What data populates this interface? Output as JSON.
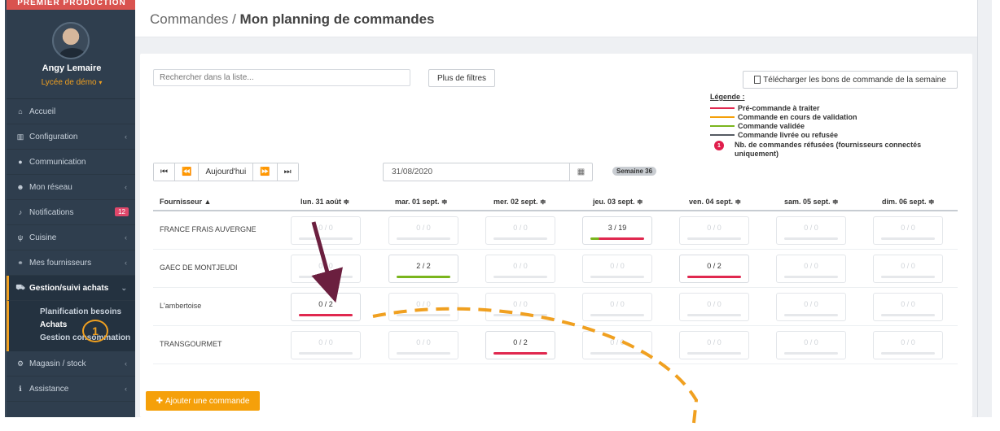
{
  "brand": "PREMIER PRODUCTION",
  "user": {
    "name": "Angy Lemaire",
    "school": "Lycée de démo"
  },
  "sidebar": {
    "items": [
      {
        "label": "Accueil",
        "icon": "home-icon"
      },
      {
        "label": "Configuration",
        "icon": "bank-icon"
      },
      {
        "label": "Communication",
        "icon": "chat-icon"
      },
      {
        "label": "Mon réseau",
        "icon": "users-icon"
      },
      {
        "label": "Notifications",
        "icon": "bell-icon",
        "badge": "12"
      },
      {
        "label": "Cuisine",
        "icon": "cutlery-icon"
      },
      {
        "label": "Mes fournisseurs",
        "icon": "handshake-icon"
      },
      {
        "label": "Gestion/suivi achats",
        "icon": "cart-icon"
      },
      {
        "label": "Magasin / stock",
        "icon": "stock-icon"
      },
      {
        "label": "Assistance",
        "icon": "info-icon"
      }
    ],
    "submenu": [
      "Planification besoins",
      "Achats",
      "Gestion consommation"
    ]
  },
  "header": {
    "crumb_root": "Commandes",
    "crumb_sep": " / ",
    "crumb_page": "Mon planning de commandes"
  },
  "search": {
    "placeholder": "Rechercher dans la liste..."
  },
  "buttons": {
    "filters": "Plus de filtres",
    "download": "Télécharger les bons de commande de la semaine",
    "add": "Ajouter une commande"
  },
  "legend": {
    "title": "Légende :",
    "items": [
      {
        "label": "Pré-commande à traiter",
        "color": "#e0284f"
      },
      {
        "label": "Commande en cours de validation",
        "color": "#f5a00a"
      },
      {
        "label": "Commande validée",
        "color": "#7ab51d"
      },
      {
        "label": "Commande livrée ou refusée",
        "color": "#555b63"
      }
    ],
    "refused": {
      "icon": "1",
      "label": "Nb. de commandes réfusées (fournisseurs connectés uniquement)"
    }
  },
  "nav": {
    "today": "Aujourd'hui",
    "date": "31/08/2020",
    "week": "Semaine 36"
  },
  "table": {
    "supplier_header": "Fournisseur ▲",
    "days": [
      "lun. 31 août ≑",
      "mar. 01 sept. ≑",
      "mer. 02 sept. ≑",
      "jeu. 03 sept. ≑",
      "ven. 04 sept. ≑",
      "sam. 05 sept. ≑",
      "dim. 06 sept. ≑"
    ],
    "rows": [
      {
        "name": "FRANCE FRAIS AUVERGNE",
        "cells": [
          {
            "v": "0 / 0"
          },
          {
            "v": "0 / 0"
          },
          {
            "v": "0 / 0"
          },
          {
            "v": "3 / 19",
            "active": true,
            "bar": "split"
          },
          {
            "v": "0 / 0"
          },
          {
            "v": "0 / 0"
          },
          {
            "v": "0 / 0"
          }
        ]
      },
      {
        "name": "GAEC DE MONTJEUDI",
        "cells": [
          {
            "v": "0 / 0"
          },
          {
            "v": "2 / 2",
            "active": true,
            "bar": "#7ab51d"
          },
          {
            "v": "0 / 0"
          },
          {
            "v": "0 / 0"
          },
          {
            "v": "0 / 2",
            "active": true,
            "bar": "#e0284f"
          },
          {
            "v": "0 / 0"
          },
          {
            "v": "0 / 0"
          }
        ]
      },
      {
        "name": "L'ambertoise",
        "cells": [
          {
            "v": "0 / 2",
            "active": true,
            "bar": "#e0284f"
          },
          {
            "v": "0 / 0"
          },
          {
            "v": "0 / 0"
          },
          {
            "v": "0 / 0"
          },
          {
            "v": "0 / 0"
          },
          {
            "v": "0 / 0"
          },
          {
            "v": "0 / 0"
          }
        ]
      },
      {
        "name": "TRANSGOURMET",
        "cells": [
          {
            "v": "0 / 0"
          },
          {
            "v": "0 / 0"
          },
          {
            "v": "0 / 2",
            "active": true,
            "bar": "#e0284f"
          },
          {
            "v": "0 / 0"
          },
          {
            "v": "0 / 0"
          },
          {
            "v": "0 / 0"
          },
          {
            "v": "0 / 0"
          }
        ]
      }
    ]
  },
  "annotation": {
    "step": "1"
  },
  "colors": {
    "sidebar": "#2f3e4e",
    "accent": "#f0a020",
    "arrow": "#6b1f3f",
    "red": "#e0284f",
    "green": "#7ab51d",
    "orange": "#f5a00a"
  }
}
